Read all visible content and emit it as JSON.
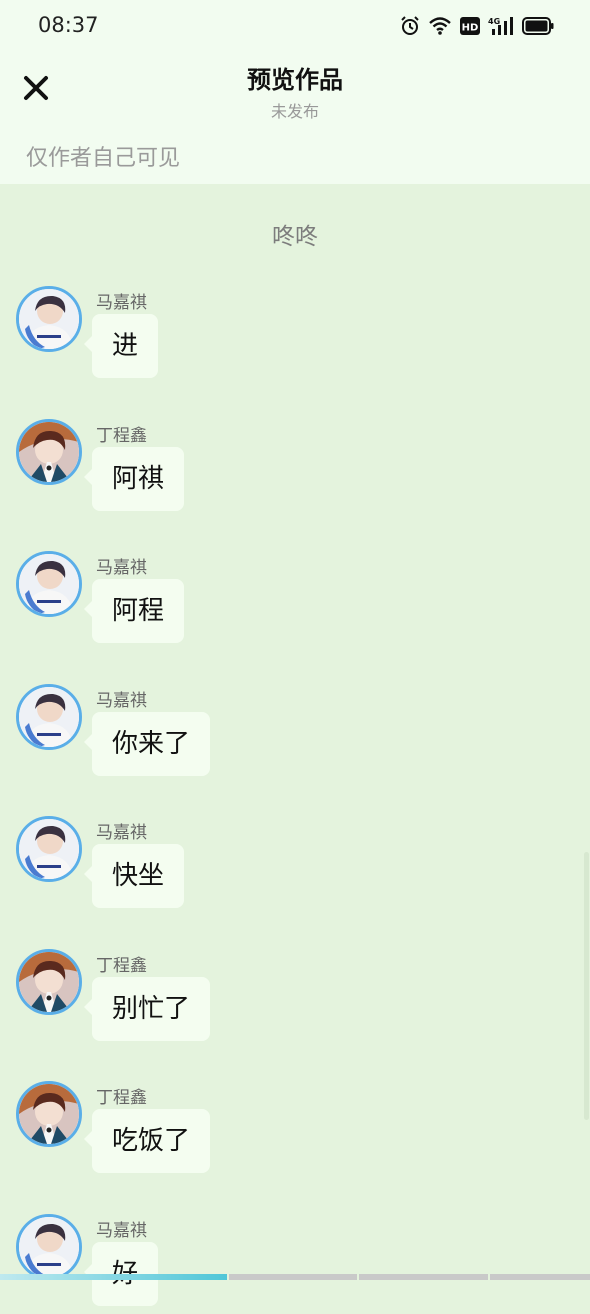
{
  "status_bar": {
    "time": "08:37",
    "icons": [
      "alarm-icon",
      "wifi-icon",
      "hd-icon",
      "4g-signal-icon",
      "battery-icon"
    ],
    "hd_label": "HD",
    "network_label": "4G"
  },
  "header": {
    "close_icon": "close-icon",
    "title": "预览作品",
    "subtitle": "未发布",
    "visibility_note": "仅作者自己可见"
  },
  "chat": {
    "section_title": "咚咚",
    "messages": [
      {
        "sender": "马嘉祺",
        "text": "进",
        "avatar": "avatar-majiaqi"
      },
      {
        "sender": "丁程鑫",
        "text": "阿祺",
        "avatar": "avatar-dingchengxin"
      },
      {
        "sender": "马嘉祺",
        "text": "阿程",
        "avatar": "avatar-majiaqi"
      },
      {
        "sender": "马嘉祺",
        "text": "你来了",
        "avatar": "avatar-majiaqi"
      },
      {
        "sender": "马嘉祺",
        "text": "快坐",
        "avatar": "avatar-majiaqi"
      },
      {
        "sender": "丁程鑫",
        "text": "别忙了",
        "avatar": "avatar-dingchengxin"
      },
      {
        "sender": "丁程鑫",
        "text": "吃饭了",
        "avatar": "avatar-dingchengxin"
      },
      {
        "sender": "马嘉祺",
        "text": "好",
        "avatar": "avatar-majiaqi"
      }
    ]
  },
  "colors": {
    "header_bg": "#f2fcf0",
    "chat_bg": "#e4f3dd",
    "bubble_bg": "#f4fdf0",
    "avatar_ring": "#5aaee8",
    "progress_active": "#4fc6d8"
  },
  "progress": {
    "segments": 4,
    "active_segment": 1
  }
}
